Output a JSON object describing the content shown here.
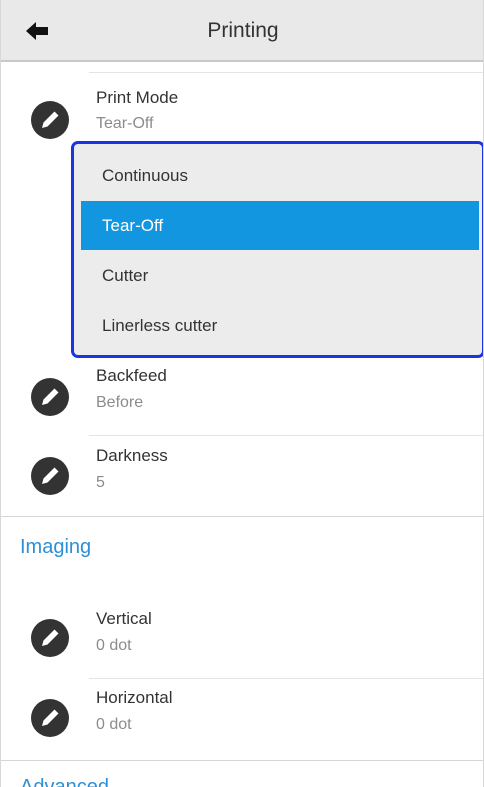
{
  "header": {
    "title": "Printing"
  },
  "settings_printing": [
    {
      "label": "Print Mode",
      "value": "Tear-Off"
    },
    {
      "label": "Backfeed",
      "value": "Before"
    },
    {
      "label": "Darkness",
      "value": "5"
    }
  ],
  "dropdown": {
    "options": [
      "Continuous",
      "Tear-Off",
      "Cutter",
      "Linerless cutter"
    ],
    "selected": "Tear-Off"
  },
  "sections": {
    "imaging": "Imaging",
    "advanced": "Advanced"
  },
  "settings_imaging": [
    {
      "label": "Vertical",
      "value": "0 dot"
    },
    {
      "label": "Horizontal",
      "value": "0 dot"
    }
  ],
  "colors": {
    "accent": "#2d8fd5",
    "selection": "#1296e0",
    "dropdown_border": "#1a35e0",
    "icon": "#333333"
  }
}
